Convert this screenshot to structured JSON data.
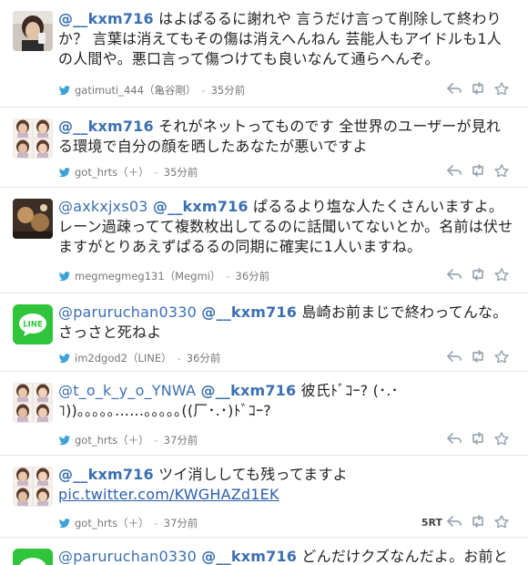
{
  "tweets": [
    {
      "avatar": "photo-selfie",
      "parts": [
        {
          "t": "@__kxm716",
          "k": "mention-strong"
        },
        {
          "t": " はよぱるるに謝れや 言うだけ言って削除して終わりか？ 言葉は消えてもその傷は消えへんねん 芸能人もアイドルも1人の人間や。悪口言って傷つけても良いなんて通らへんぞ。",
          "k": "text"
        }
      ],
      "user": "gatimuti_444",
      "name": "（亀谷剛）",
      "time": "35分前",
      "rt": ""
    },
    {
      "avatar": "photo-group",
      "parts": [
        {
          "t": "@__kxm716",
          "k": "mention-strong"
        },
        {
          "t": " それがネットってものです 全世界のユーザーが見れる環境で自分の顔を晒したあなたが悪いですよ",
          "k": "text"
        }
      ],
      "user": "got_hrts",
      "name": "（＋）",
      "time": "35分前",
      "rt": ""
    },
    {
      "avatar": "photo-dark",
      "parts": [
        {
          "t": "@axkxjxs03",
          "k": "mention"
        },
        {
          "t": " ",
          "k": "text"
        },
        {
          "t": "@__kxm716",
          "k": "mention-strong"
        },
        {
          "t": " ぱるるより塩な人たくさんいますよ。レーン過疎ってて複数枚出してるのに話聞いてないとか。名前は伏せますがとりあえずぱるるの同期に確実に1人いますね。",
          "k": "text"
        }
      ],
      "user": "megmegmeg131",
      "name": "（Megmi）",
      "time": "36分前",
      "rt": ""
    },
    {
      "avatar": "line-logo",
      "parts": [
        {
          "t": "@paruruchan0330",
          "k": "mention"
        },
        {
          "t": " ",
          "k": "text"
        },
        {
          "t": "@__kxm716",
          "k": "mention-strong"
        },
        {
          "t": " 島崎お前まじで終わってんな。さっさと死ねよ",
          "k": "text"
        }
      ],
      "user": "im2dgod2",
      "name": "（LINE）",
      "time": "36分前",
      "rt": ""
    },
    {
      "avatar": "photo-group",
      "parts": [
        {
          "t": "@t_o_k_y_o_YNWA",
          "k": "mention"
        },
        {
          "t": " ",
          "k": "text"
        },
        {
          "t": "@__kxm716",
          "k": "mention-strong"
        },
        {
          "t": " 彼氏ﾄﾞｺｰ? (･.･ ˥))｡｡｡｡｡……｡｡｡｡｡((厂･.･)ﾄﾞｺｰ?",
          "k": "text"
        }
      ],
      "user": "got_hrts",
      "name": "（＋）",
      "time": "37分前",
      "rt": ""
    },
    {
      "avatar": "photo-group",
      "parts": [
        {
          "t": "@__kxm716",
          "k": "mention-strong"
        },
        {
          "t": " ツイ消ししても残ってますよ",
          "k": "text"
        },
        {
          "t": "pic.twitter.com/KWGHAZd1EK",
          "k": "link"
        }
      ],
      "user": "got_hrts",
      "name": "（＋）",
      "time": "37分前",
      "rt": "5RT"
    },
    {
      "avatar": "line-logo",
      "parts": [
        {
          "t": "@paruruchan0330",
          "k": "mention"
        },
        {
          "t": " ",
          "k": "text"
        },
        {
          "t": "@__kxm716",
          "k": "mention-strong"
        },
        {
          "t": " どんだけクズなんだよ。お前とお",
          "k": "text"
        }
      ],
      "user": "",
      "name": "",
      "time": "",
      "rt": ""
    }
  ],
  "colors": {
    "mention": "#3a6fb2",
    "line_green": "#2fc43a",
    "bird": "#3ea1d8",
    "action_icon": "#9aa7b3"
  },
  "icons": [
    "twitter-bird-icon",
    "reply-icon",
    "retweet-icon",
    "favorite-star-icon"
  ]
}
